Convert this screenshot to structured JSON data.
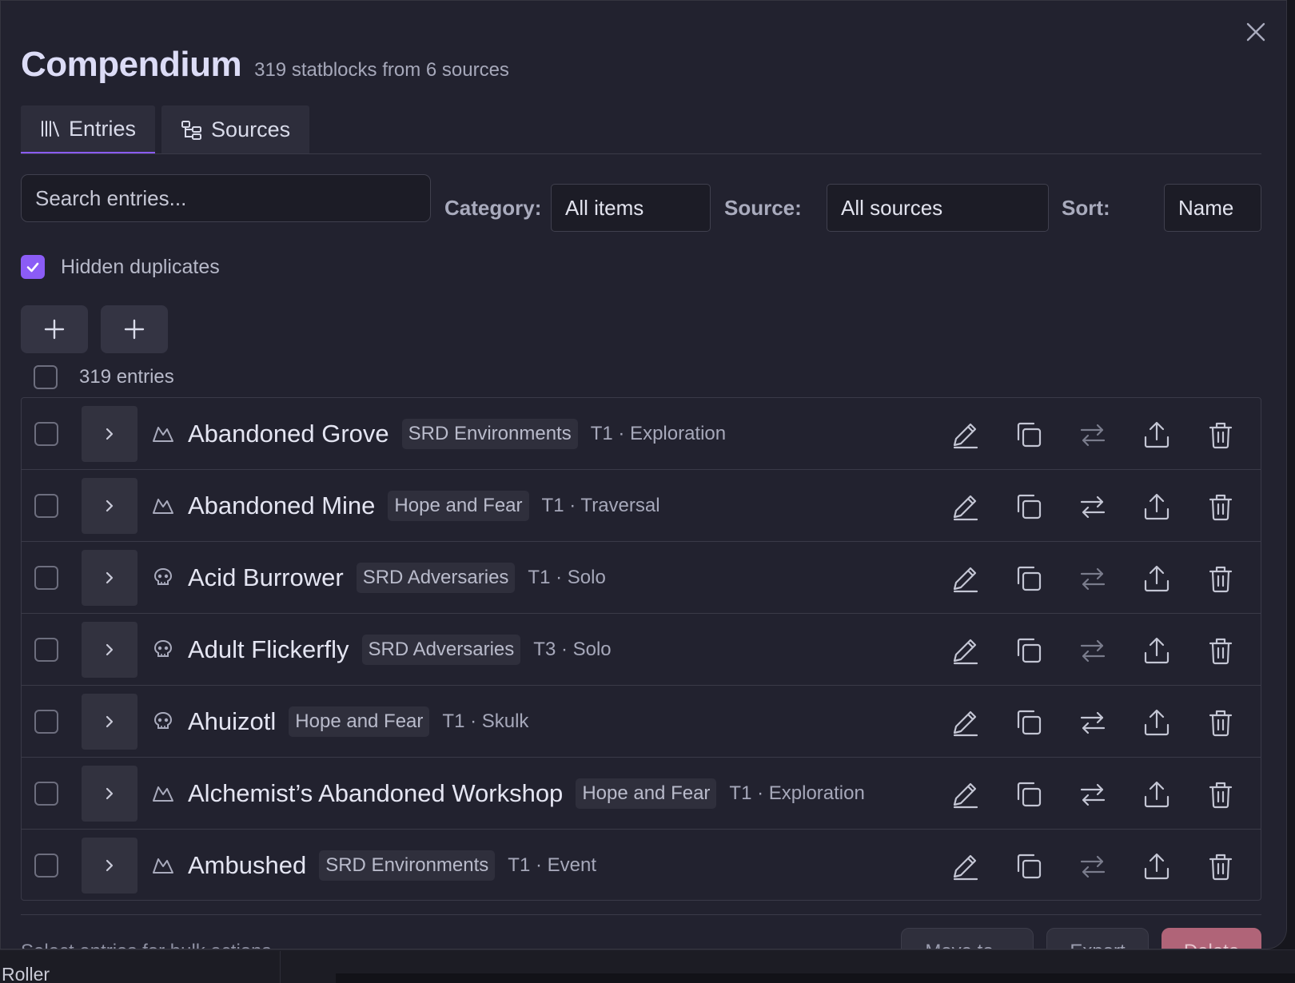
{
  "header": {
    "title": "Compendium",
    "subtitle": "319 statblocks from 6 sources"
  },
  "tabs": [
    {
      "label": "Entries",
      "icon": "library-icon",
      "active": true
    },
    {
      "label": "Sources",
      "icon": "tree-icon",
      "active": false
    }
  ],
  "filters": {
    "search_placeholder": "Search entries...",
    "category_label": "Category:",
    "category_value": "All items",
    "source_label": "Source:",
    "source_value": "All sources",
    "sort_label": "Sort:",
    "sort_value": "Name"
  },
  "hidden_duplicates": {
    "label": "Hidden duplicates",
    "checked": true
  },
  "entries_count": "319 entries",
  "entries": [
    {
      "name": "Abandoned Grove",
      "source": "SRD Environments",
      "meta": "T1 · Exploration",
      "type": "environment",
      "swap_dim": true
    },
    {
      "name": "Abandoned Mine",
      "source": "Hope and Fear",
      "meta": "T1 · Traversal",
      "type": "environment",
      "swap_dim": false
    },
    {
      "name": "Acid Burrower",
      "source": "SRD Adversaries",
      "meta": "T1 · Solo",
      "type": "adversary",
      "swap_dim": true
    },
    {
      "name": "Adult Flickerfly",
      "source": "SRD Adversaries",
      "meta": "T3 · Solo",
      "type": "adversary",
      "swap_dim": true
    },
    {
      "name": "Ahuizotl",
      "source": "Hope and Fear",
      "meta": "T1 · Skulk",
      "type": "adversary",
      "swap_dim": false
    },
    {
      "name": "Alchemist’s Abandoned Workshop",
      "source": "Hope and Fear",
      "meta": "T1 · Exploration",
      "type": "environment",
      "swap_dim": false
    },
    {
      "name": "Ambushed",
      "source": "SRD Environments",
      "meta": "T1 · Event",
      "type": "environment",
      "swap_dim": true
    }
  ],
  "footer": {
    "hint": "Select entries for bulk actions",
    "move_label": "Move to...",
    "export_label": "Export",
    "delete_label": "Delete"
  },
  "background": {
    "app_label": "Roller"
  },
  "colors": {
    "accent": "#8b5cf6",
    "danger": "#b06478"
  }
}
